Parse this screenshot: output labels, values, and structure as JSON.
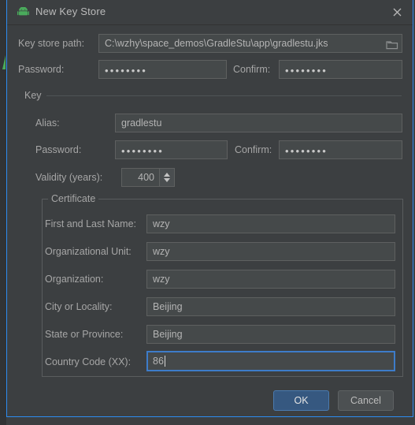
{
  "window": {
    "title": "New Key Store",
    "icon": "android-icon",
    "close_icon": "close-icon",
    "accent_border": "#2d8cf0",
    "background": "#3c3f41"
  },
  "keystore": {
    "path_label": "Key store path:",
    "path_value": "C:\\wzhy\\space_demos\\GradleStu\\app\\gradlestu.jks",
    "browse_icon": "folder-icon",
    "password_label": "Password:",
    "password_value": "••••••••",
    "confirm_label": "Confirm:",
    "confirm_value": "••••••••"
  },
  "key": {
    "group_label": "Key",
    "alias_label": "Alias:",
    "alias_value": "gradlestu",
    "password_label": "Password:",
    "password_value": "••••••••",
    "confirm_label": "Confirm:",
    "confirm_value": "••••••••",
    "validity_label": "Validity (years):",
    "validity_value": "400"
  },
  "certificate": {
    "group_label": "Certificate",
    "fields": [
      {
        "label": "First and Last Name:",
        "value": "wzy",
        "focused": false
      },
      {
        "label": "Organizational Unit:",
        "value": "wzy",
        "focused": false
      },
      {
        "label": "Organization:",
        "value": "wzy",
        "focused": false
      },
      {
        "label": "City or Locality:",
        "value": "Beijing",
        "focused": false
      },
      {
        "label": "State or Province:",
        "value": "Beijing",
        "focused": false
      },
      {
        "label": "Country Code (XX):",
        "value": "86",
        "focused": true
      }
    ]
  },
  "footer": {
    "ok_label": "OK",
    "cancel_label": "Cancel",
    "ok_color": "#365880"
  }
}
